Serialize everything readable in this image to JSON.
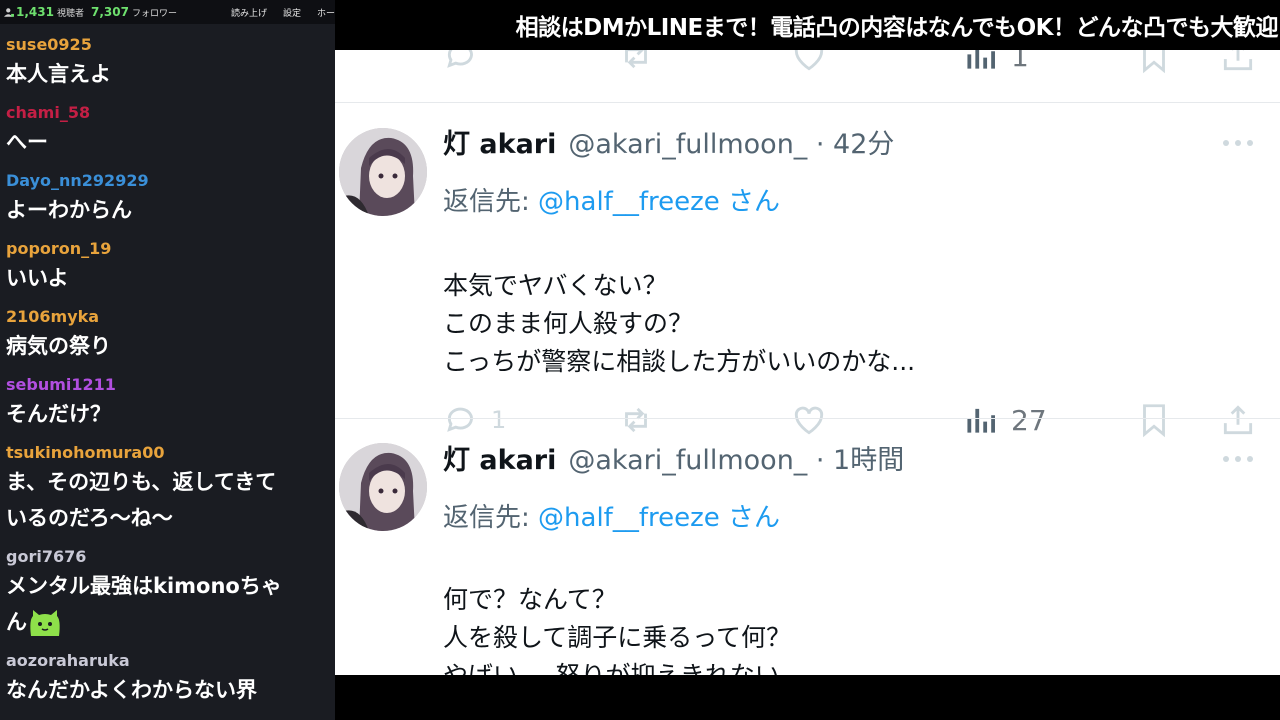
{
  "chat": {
    "stats": {
      "viewers_value": "1,431",
      "viewers_label": "視聴者",
      "followers_value": "7,307",
      "followers_label": "フォロワー"
    },
    "buttons": [
      "読み上げ",
      "設定",
      "ホー"
    ],
    "messages": [
      {
        "user": "suse0925",
        "color": "#e8a33c",
        "text": [
          "本人言えよ"
        ]
      },
      {
        "user": "chami_58",
        "color": "#c41f45",
        "text": [
          "へー"
        ]
      },
      {
        "user": "Dayo_nn292929",
        "color": "#3a8fd8",
        "text": [
          "よーわからん"
        ]
      },
      {
        "user": "poporon_19",
        "color": "#e8a33c",
        "text": [
          "いいよ"
        ]
      },
      {
        "user": "2106myka",
        "color": "#e8a33c",
        "text": [
          "病気の祭り"
        ]
      },
      {
        "user": "sebumi1211",
        "color": "#b14fe0",
        "text": [
          "そんだけ？"
        ]
      },
      {
        "user": "tsukinohomura00",
        "color": "#e8a33c",
        "text": [
          "ま、その辺りも、返してきて",
          "いるのだろ～ね～"
        ]
      },
      {
        "user": "gori7676",
        "color": "#c9c9d6",
        "text": [
          "メンタル最強はkimonoちゃ",
          "ん"
        ],
        "emote": "cat-emote"
      },
      {
        "user": "aozoraharuka",
        "color": "#c9c9d6",
        "text": [
          "なんだかよくわからない界"
        ]
      }
    ]
  },
  "banner": {
    "text": "相談はDMかLINEまで！電話凸の内容はなんでもOK！どんな凸でも大歓迎"
  },
  "feed": {
    "top_actions": {
      "views": "1"
    },
    "tweets": [
      {
        "name": "灯 akari",
        "handle": "@akari_fullmoon_ · 42分",
        "reply_label": "返信先: ",
        "reply_to": "@half__freeze さん",
        "body": [
          "本気でヤバくない？",
          "このまま何人殺すの？",
          "こっちが警察に相談した方がいいのかな..."
        ],
        "replies": "1",
        "views": "27"
      },
      {
        "name": "灯 akari",
        "handle": "@akari_fullmoon_ · 1時間",
        "reply_label": "返信先: ",
        "reply_to": "@half__freeze さん",
        "body": [
          "何で？なんて？",
          "人を殺して調子に乗るって何？",
          "やばい、、怒りが抑えきれない"
        ]
      }
    ]
  },
  "colors": {
    "chat_bg": "#1a1c22",
    "count_green": "#6ee06e",
    "mention_blue": "#1d9bf0",
    "icon_gray": "#cfd9de"
  },
  "icons": [
    "viewers-icon",
    "reply-icon",
    "retweet-icon",
    "like-icon",
    "views-icon",
    "bookmark-icon",
    "share-icon",
    "more-icon",
    "cat-emote"
  ]
}
